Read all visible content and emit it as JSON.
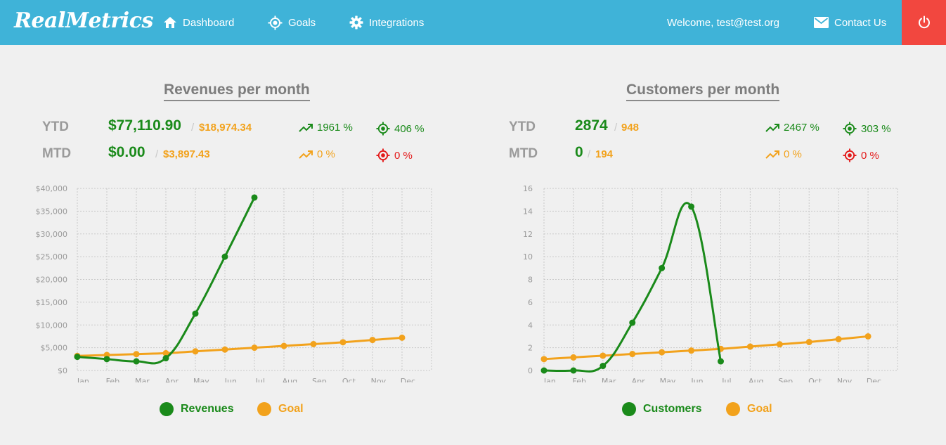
{
  "app": {
    "logo": "RealMetrics"
  },
  "nav": {
    "dashboard": "Dashboard",
    "goals": "Goals",
    "integrations": "Integrations",
    "welcome": "Welcome, test@test.org",
    "contact": "Contact Us"
  },
  "colors": {
    "header": "#3fb3d8",
    "power": "#f2473f",
    "actual": "#1a8a1a",
    "goal": "#f2a21c",
    "miss": "#e31919"
  },
  "revenues": {
    "title": "Revenues per month",
    "ytd": {
      "label": "YTD",
      "value": "$77,110.90",
      "goal": "$18,974.34",
      "trend": "1961 %",
      "target": "406 %"
    },
    "mtd": {
      "label": "MTD",
      "value": "$0.00",
      "goal": "$3,897.43",
      "trend": "0 %",
      "target": "0 %"
    },
    "legend": {
      "actual": "Revenues",
      "goal": "Goal"
    }
  },
  "customers": {
    "title": "Customers per month",
    "ytd": {
      "label": "YTD",
      "value": "2874",
      "goal": "948",
      "trend": "2467 %",
      "target": "303 %"
    },
    "mtd": {
      "label": "MTD",
      "value": "0",
      "goal": "194",
      "trend": "0 %",
      "target": "0 %"
    },
    "legend": {
      "actual": "Customers",
      "goal": "Goal"
    }
  },
  "chart_data": [
    {
      "type": "line",
      "title": "Revenues per month",
      "x": [
        "Jan",
        "Feb",
        "Mar",
        "Apr",
        "May",
        "Jun",
        "Jul",
        "Aug",
        "Sep",
        "Oct",
        "Nov",
        "Dec"
      ],
      "y_ticks": [
        "$0",
        "$5,000",
        "$10,000",
        "$15,000",
        "$20,000",
        "$25,000",
        "$30,000",
        "$35,000",
        "$40,000"
      ],
      "ylim": [
        0,
        40000
      ],
      "grid": true,
      "legend_position": "bottom",
      "series": [
        {
          "name": "Revenues",
          "values": [
            3000,
            2500,
            2000,
            2700,
            12500,
            25000,
            38000
          ]
        },
        {
          "name": "Goal",
          "values": [
            3200,
            3400,
            3600,
            3800,
            4200,
            4600,
            5000,
            5400,
            5800,
            6200,
            6700,
            7200
          ]
        }
      ]
    },
    {
      "type": "line",
      "title": "Customers per month",
      "x": [
        "Jan",
        "Feb",
        "Mar",
        "Apr",
        "May",
        "Jun",
        "Jul",
        "Aug",
        "Sep",
        "Oct",
        "Nov",
        "Dec"
      ],
      "y_ticks": [
        "0",
        "2",
        "4",
        "6",
        "8",
        "10",
        "12",
        "14",
        "16"
      ],
      "ylim": [
        0,
        16
      ],
      "grid": true,
      "legend_position": "bottom",
      "series": [
        {
          "name": "Customers",
          "values": [
            0,
            0,
            0.4,
            4.2,
            9,
            14.4,
            0.8
          ]
        },
        {
          "name": "Goal",
          "values": [
            1,
            1.15,
            1.3,
            1.45,
            1.6,
            1.75,
            1.9,
            2.1,
            2.3,
            2.5,
            2.75,
            3
          ]
        }
      ]
    }
  ]
}
